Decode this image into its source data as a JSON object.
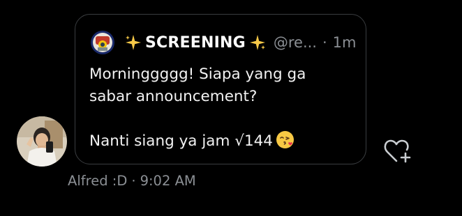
{
  "quote": {
    "author_name": "SCREENING",
    "author_handle": "@re...",
    "separator": "·",
    "time": "1m",
    "text_line_1": "Morninggggg! Siapa yang ga",
    "text_line_2": "sabar announcement?",
    "text_line_3": "Nanti siang ya jam √144",
    "emoji": "face-blowing-kiss",
    "sparkle_icon": "sparkles-emoji"
  },
  "message": {
    "sender": "Alfred :D",
    "separator": "·",
    "time": "9:02 AM"
  },
  "colors": {
    "background": "#000000",
    "bubble_border": "#3a3d40",
    "secondary_text": "#8b8f94",
    "primary_text": "#ffffff"
  },
  "icons": {
    "like": "heart-plus-icon",
    "avatar": "user-avatar",
    "quoted_avatar": "quoted-account-avatar"
  }
}
